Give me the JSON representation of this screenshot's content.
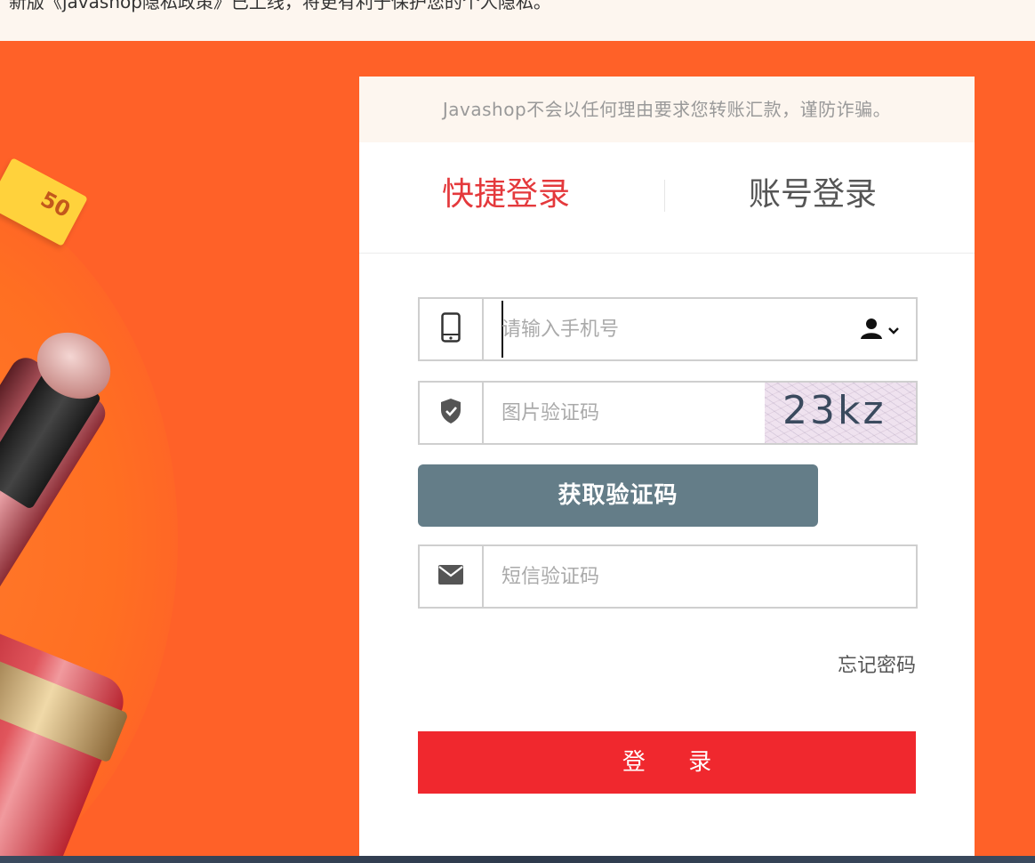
{
  "notice": {
    "text": "新版《javashop隐私政策》已上线，将更有利于保护您的个人隐私。"
  },
  "login": {
    "warning": "Javashop不会以任何理由要求您转账汇款，谨防诈骗。",
    "tabs": {
      "quick": "快捷登录",
      "account": "账号登录"
    },
    "phone": {
      "placeholder": "请输入手机号"
    },
    "captcha": {
      "placeholder": "图片验证码",
      "image_text": "23kz"
    },
    "get_code_label": "获取验证码",
    "sms": {
      "placeholder": "短信验证码"
    },
    "forgot_label": "忘记密码",
    "submit_label": "登 录"
  },
  "banner": {
    "coupon_text": "50"
  },
  "colors": {
    "accent": "#e4393c",
    "banner": "#ff6128",
    "get_code_button": "#647d88",
    "login_button": "#f0282e"
  },
  "icons": [
    "mobile-phone-icon",
    "user-icon",
    "chevron-down-icon",
    "shield-check-icon",
    "envelope-icon"
  ]
}
